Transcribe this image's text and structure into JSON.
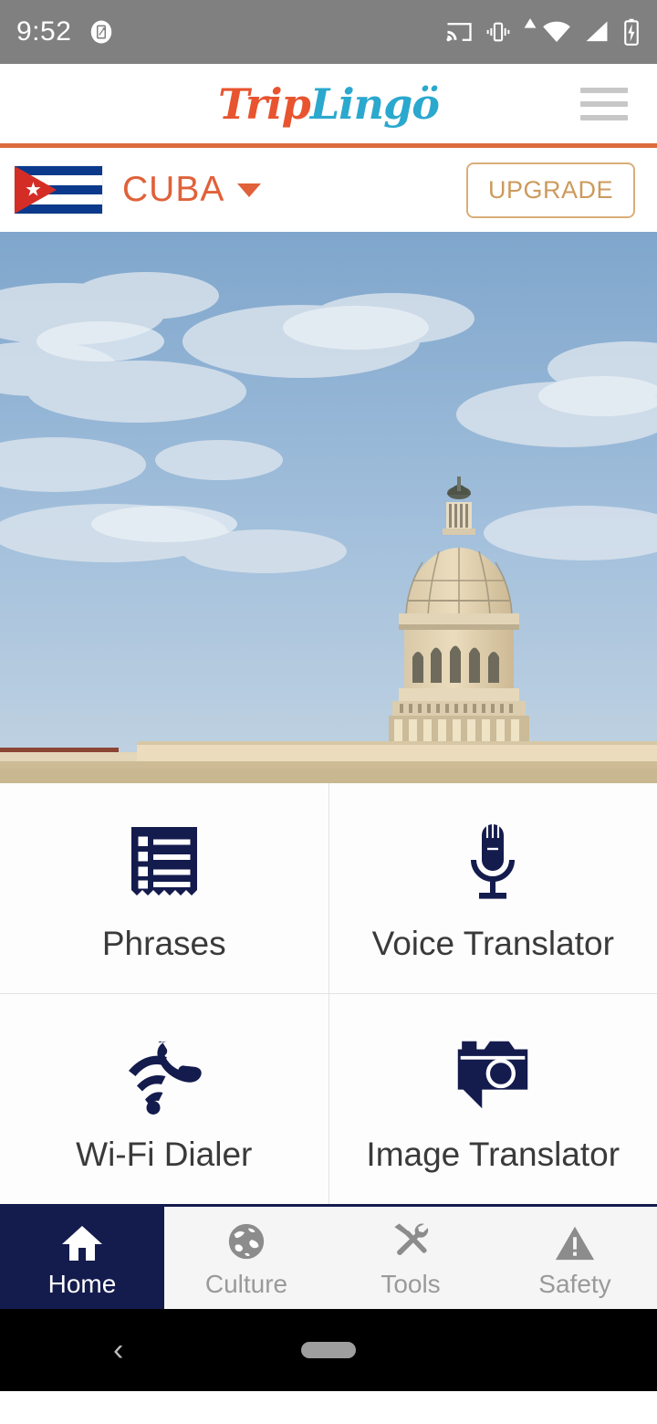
{
  "status_bar": {
    "time": "9:52",
    "left_icons": [
      "screenshot-icon"
    ],
    "right_icons": [
      "cast-icon",
      "vibrate-icon",
      "triangle-up-icon",
      "wifi-icon",
      "cellular-signal-icon",
      "battery-charging-icon"
    ],
    "background_color": "#808080"
  },
  "header": {
    "logo_part1": "Trip",
    "logo_part2": "Lingö",
    "logo_color_1": "#E8542F",
    "logo_color_2": "#2BA8CE",
    "menu_icon": "hamburger-menu-icon",
    "accent_underline_color": "#DE6B3C"
  },
  "country_bar": {
    "flag": "cuba-flag",
    "country": "CUBA",
    "country_color": "#E0613A",
    "dropdown_icon": "chevron-down-icon",
    "upgrade_label": "UPGRADE",
    "upgrade_border_color": "#D9AE78",
    "upgrade_text_color": "#CC9A5C"
  },
  "hero": {
    "alt": "El Capitolio dome in Havana, Cuba at golden hour",
    "sky_color": "#8FB2D4",
    "building_color": "#E3D4B4"
  },
  "features": [
    {
      "label": "Phrases",
      "icon": "phrase-list-icon"
    },
    {
      "label": "Voice Translator",
      "icon": "microphone-icon"
    },
    {
      "label": "Wi-Fi Dialer",
      "icon": "wifi-phone-icon"
    },
    {
      "label": "Image Translator",
      "icon": "camera-bubble-icon"
    }
  ],
  "feature_icon_color": "#141B4D",
  "tabs": [
    {
      "label": "Home",
      "icon": "home-icon",
      "active": true
    },
    {
      "label": "Culture",
      "icon": "globe-icon",
      "active": false
    },
    {
      "label": "Tools",
      "icon": "tools-icon",
      "active": false
    },
    {
      "label": "Safety",
      "icon": "warning-triangle-icon",
      "active": false
    }
  ],
  "tab_active_bg": "#141B4D",
  "tab_inactive_color": "#9A9A9A",
  "nav_bar": {
    "back_icon": "back-chevron-icon",
    "home_indicator": "home-pill-indicator"
  }
}
